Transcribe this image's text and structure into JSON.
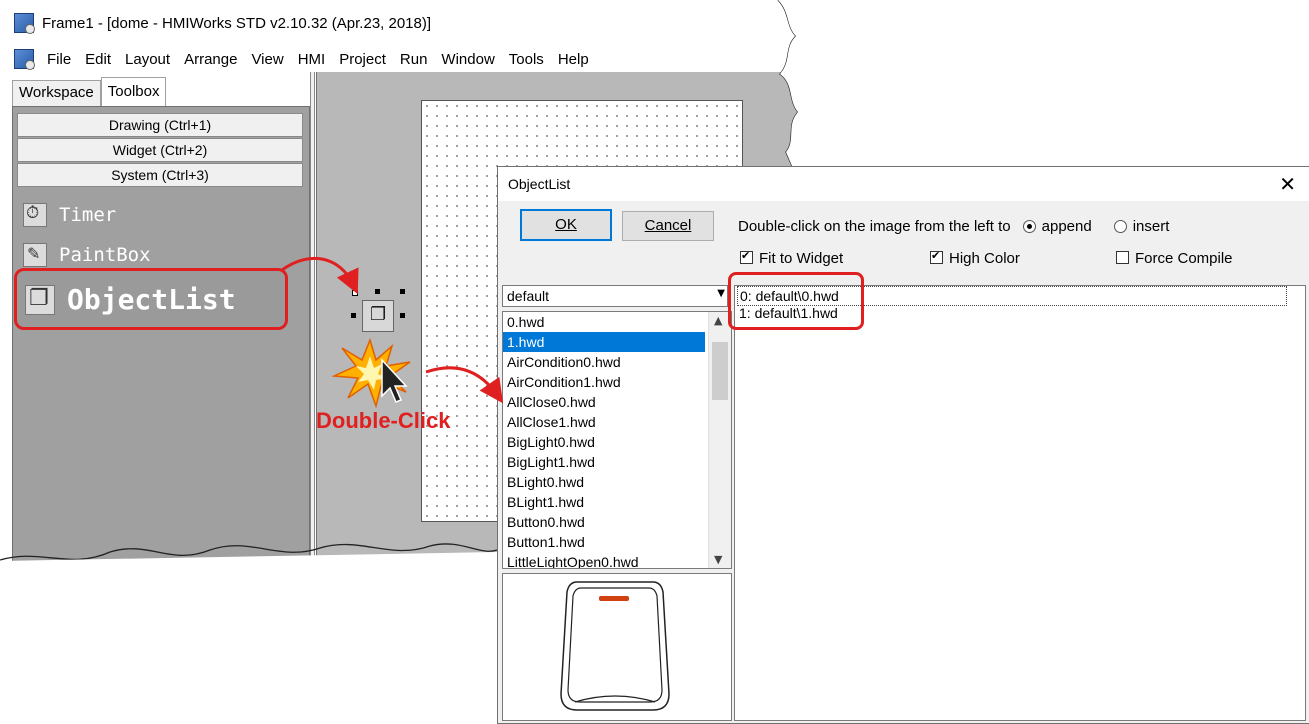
{
  "back_window": {
    "title": "Frame1 - [dome - HMIWorks STD v2.10.32 (Apr.23, 2018)]",
    "menu": [
      "File",
      "Edit",
      "Layout",
      "Arrange",
      "View",
      "HMI",
      "Project",
      "Run",
      "Window",
      "Tools",
      "Help"
    ],
    "tabs": [
      "Workspace",
      "Toolbox"
    ],
    "toolbox_categories": [
      "Drawing (Ctrl+1)",
      "Widget (Ctrl+2)",
      "System (Ctrl+3)"
    ],
    "toolbox_items": [
      {
        "label": "Timer",
        "icon": "timer-icon"
      },
      {
        "label": "PaintBox",
        "icon": "paintbox-icon"
      },
      {
        "label": "ObjectList",
        "icon": "objectlist-icon"
      }
    ]
  },
  "annotation": {
    "double_click_label": "Double-Click",
    "accent_color": "#e02020"
  },
  "dialog": {
    "title": "ObjectList",
    "ok_label": "OK",
    "cancel_label": "Cancel",
    "instruction": "Double-click on the image from the left to",
    "radio_append": "append",
    "radio_insert": "insert",
    "append_selected": true,
    "fit_to_widget": "Fit to Widget",
    "fit_to_widget_checked": true,
    "high_color": "High Color",
    "high_color_checked": true,
    "force_compile": "Force Compile",
    "force_compile_checked": false,
    "folder": "default",
    "files": [
      "0.hwd",
      "1.hwd",
      "AirCondition0.hwd",
      "AirCondition1.hwd",
      "AllClose0.hwd",
      "AllClose1.hwd",
      "BigLight0.hwd",
      "BigLight1.hwd",
      "BLight0.hwd",
      "BLight1.hwd",
      "Button0.hwd",
      "Button1.hwd",
      "LittleLightOpen0.hwd"
    ],
    "selected_file": "1.hwd",
    "object_list": [
      "0: default\\0.hwd",
      "1: default\\1.hwd"
    ]
  }
}
